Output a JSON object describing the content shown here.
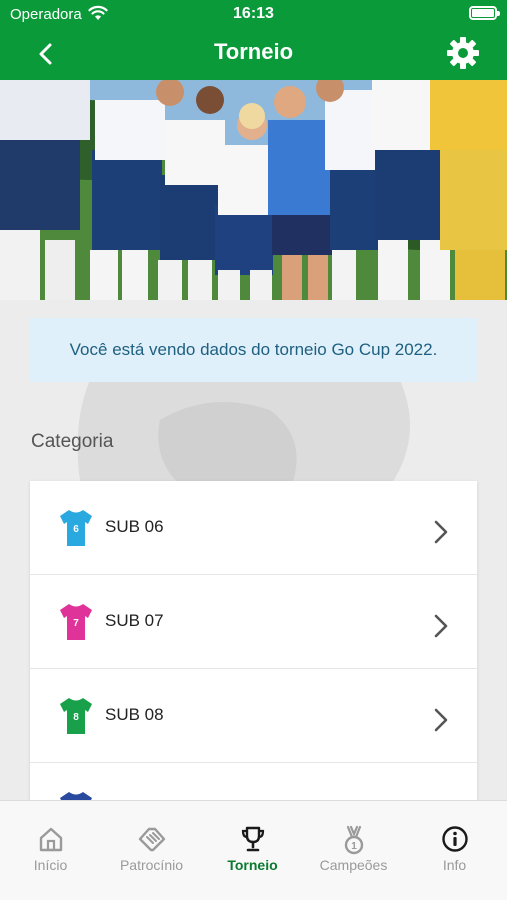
{
  "status_bar": {
    "carrier": "Operadora",
    "time": "16:13"
  },
  "nav": {
    "title": "Torneio"
  },
  "notice": {
    "text": "Você está vendo dados do torneio Go Cup 2022."
  },
  "section": {
    "title": "Categoria"
  },
  "categories": [
    {
      "label": "SUB 06",
      "jersey_number": "6",
      "jersey_color": "#2aa8e0"
    },
    {
      "label": "SUB 07",
      "jersey_number": "7",
      "jersey_color": "#e0339a"
    },
    {
      "label": "SUB 08",
      "jersey_number": "8",
      "jersey_color": "#18a04a"
    },
    {
      "label": "",
      "jersey_number": "",
      "jersey_color": "#2a4aa0"
    }
  ],
  "tabs": [
    {
      "label": "Início",
      "icon": "home-icon"
    },
    {
      "label": "Patrocínio",
      "icon": "handshake-icon"
    },
    {
      "label": "Torneio",
      "icon": "trophy-icon"
    },
    {
      "label": "Campeões",
      "icon": "medal-icon"
    },
    {
      "label": "Info",
      "icon": "info-icon"
    }
  ],
  "colors": {
    "brand": "#0a9a3a",
    "notice_bg": "#dff0fb",
    "notice_text": "#1f5f7f",
    "tab_active": "#0a7a30"
  }
}
